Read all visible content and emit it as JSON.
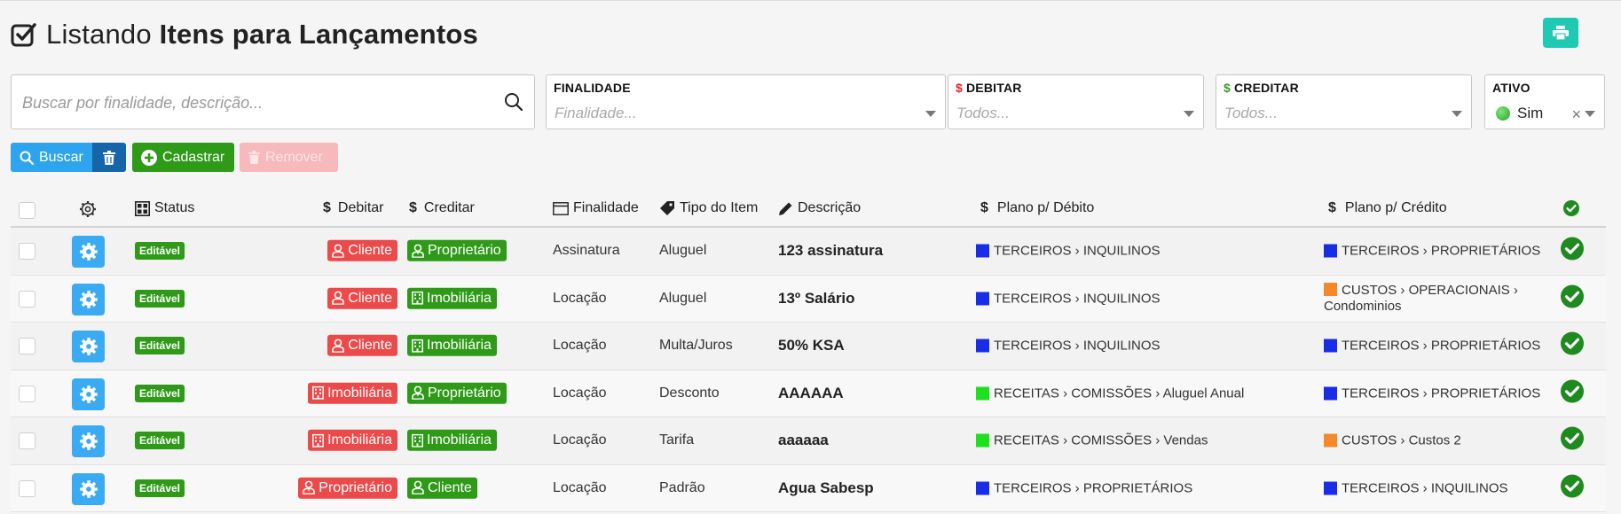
{
  "header": {
    "title_prefix": "Listando ",
    "title_bold": "Itens para Lançamentos"
  },
  "filters": {
    "search_placeholder": "Buscar por finalidade, descrição...",
    "finalidade": {
      "label": "FINALIDADE",
      "placeholder": "Finalidade..."
    },
    "debitar": {
      "label": "DEBITAR",
      "placeholder": "Todos..."
    },
    "creditar": {
      "label": "CREDITAR",
      "placeholder": "Todos..."
    },
    "ativo": {
      "label": "ATIVO",
      "value": "Sim"
    }
  },
  "actions": {
    "search_label": "Buscar",
    "add_label": "Cadastrar",
    "remove_label": "Remover"
  },
  "table": {
    "columns": {
      "status": "Status",
      "debitar": "Debitar",
      "creditar": "Creditar",
      "finalidade": "Finalidade",
      "tipo": "Tipo do Item",
      "descricao": "Descrição",
      "plano_debito": "Plano p/ Débito",
      "plano_credito": "Plano p/ Crédito"
    },
    "rows": [
      {
        "status": "Editável",
        "debitar": "Cliente",
        "creditar": "Proprietário",
        "finalidade": "Assinatura",
        "tipo": "Aluguel",
        "descricao": "123 assinatura",
        "plano_debito": "TERCEIROS › INQUILINOS",
        "plano_credito": "TERCEIROS › PROPRIETÁRIOS"
      },
      {
        "status": "Editável",
        "debitar": "Cliente",
        "creditar": "Imobiliária",
        "finalidade": "Locação",
        "tipo": "Aluguel",
        "descricao": "13º Salário",
        "plano_debito": "TERCEIROS › INQUILINOS",
        "plano_credito": "CUSTOS › OPERACIONAIS › Condominios"
      },
      {
        "status": "Editável",
        "debitar": "Cliente",
        "creditar": "Imobiliária",
        "finalidade": "Locação",
        "tipo": "Multa/Juros",
        "descricao": "50% KSA",
        "plano_debito": "TERCEIROS › INQUILINOS",
        "plano_credito": "TERCEIROS › PROPRIETÁRIOS"
      },
      {
        "status": "Editável",
        "debitar": "Imobiliária",
        "creditar": "Proprietário",
        "finalidade": "Locação",
        "tipo": "Desconto",
        "descricao": "AAAAAA",
        "plano_debito": "RECEITAS › COMISSÕES › Aluguel Anual",
        "plano_credito": "TERCEIROS › PROPRIETÁRIOS"
      },
      {
        "status": "Editável",
        "debitar": "Imobiliária",
        "creditar": "Imobiliária",
        "finalidade": "Locação",
        "tipo": "Tarifa",
        "descricao": "aaaaaa",
        "plano_debito": "RECEITAS › COMISSÕES › Vendas",
        "plano_credito": "CUSTOS › Custos 2"
      },
      {
        "status": "Editável",
        "debitar": "Proprietário",
        "creditar": "Cliente",
        "finalidade": "Locação",
        "tipo": "Padrão",
        "descricao": "Agua Sabesp",
        "plano_debito": "TERCEIROS › PROPRIETÁRIOS",
        "plano_credito": "TERCEIROS › INQUILINOS"
      }
    ]
  },
  "colors": {
    "accent_blue": "#3aabf2",
    "green": "#2e9a18",
    "red_tag": "#ea4a4a",
    "plano_blue": "#1a2de6",
    "plano_green": "#1ee01e",
    "plano_orange": "#f5892a",
    "print_teal": "#20c9b2"
  }
}
